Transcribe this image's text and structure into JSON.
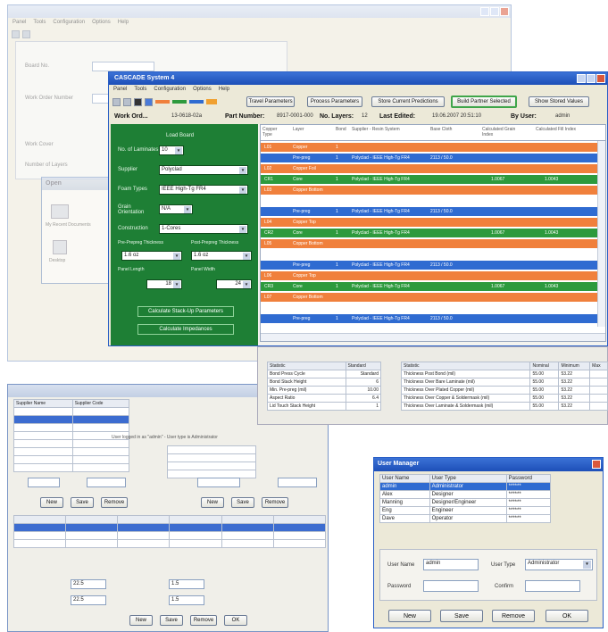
{
  "bg_window": {
    "title": "",
    "menu": [
      "Panel",
      "Tools",
      "Configuration",
      "Options",
      "Help"
    ],
    "field_labels": [
      "Board No.",
      "Work Order Number",
      "Work Cover",
      "Number of Layers"
    ]
  },
  "explorer": {
    "title": "Open",
    "items": [
      "My Recent Documents",
      "Desktop"
    ]
  },
  "left_window": {
    "status": "User logged in as \"admin\" - User type is Administrator",
    "table_headers": [
      "Supplier Name",
      "Supplier Code"
    ],
    "buttons": [
      "New",
      "Save",
      "Remove"
    ],
    "mid_buttons": [
      "New",
      "Save",
      "Remove"
    ],
    "bottom_buttons": [
      "New",
      "Save",
      "Remove",
      "OK"
    ],
    "inputs": [
      "22.5",
      "1.5",
      "22.5",
      "1.5"
    ]
  },
  "main_window": {
    "title": "CASCADE System 4",
    "menu": [
      "Panel",
      "Tools",
      "Configuration",
      "Options",
      "Help"
    ],
    "buttons": [
      "Travel Parameters",
      "Process Parameters",
      "Store Current Predictions",
      "Build Partner Selected",
      "Show Stored Values"
    ],
    "info": {
      "work_order_label": "Work Ord...",
      "work_order_value": "13-0618-02a",
      "part_number_label": "Part Number:",
      "part_number_value": "8917-0001-000",
      "layers_label": "No. Layers:",
      "layers_value": "12",
      "last_edited_label": "Last Edited:",
      "last_edited_value": "19.06.2007 20:51:10",
      "by_user_label": "By User:",
      "by_user_value": "admin"
    },
    "panel": {
      "heading": "Load Board",
      "fields": [
        {
          "label": "No. of Laminates",
          "value": "10"
        },
        {
          "label": "Supplier",
          "value": "Polyclad"
        },
        {
          "label": "Foam Types",
          "value": "IEEE High-Tg FR4"
        },
        {
          "label": "Grain Orientation",
          "value": "N/A"
        },
        {
          "label": "Construction",
          "value": "1-Cores"
        }
      ],
      "pair_labels": [
        "Pre-Prepreg Thickness",
        "Post-Prepreg Thickness"
      ],
      "pair_values": [
        "1.6 oz",
        "1.6 oz"
      ],
      "dim_labels": [
        "Panel Length",
        "Panel Width"
      ],
      "dim_values": [
        "18",
        "24"
      ],
      "action_buttons": [
        "Calculate Stack-Up Parameters",
        "Calculate Impedances"
      ]
    },
    "grid_headers": [
      "Copper Type",
      "Layer",
      "Bond",
      "Supplier - Resin System",
      "Base Cloth",
      "Calculated Grain Index",
      "Calculated Fill Index"
    ],
    "rows": [
      {
        "color": "o",
        "c1": "L01",
        "c2": "Copper",
        "c3": "1",
        "c4": "",
        "c5": "",
        "c6": "",
        "c7": ""
      },
      {
        "color": "b",
        "c1": "",
        "c2": "Pre-preg",
        "c3": "1",
        "c4": "Polyclad - IEEE High-Tg FR4",
        "c5": "2113 / 50.0",
        "c6": "",
        "c7": ""
      },
      {
        "color": "o",
        "c1": "L02",
        "c2": "Copper Foil",
        "c3": "",
        "c4": "",
        "c5": "",
        "c6": "",
        "c7": ""
      },
      {
        "color": "g",
        "c1": "CR1",
        "c2": "Core",
        "c3": "1",
        "c4": "Polyclad - IEEE High-Tg FR4",
        "c5": "",
        "c6": "1.0067",
        "c7": "1.0043"
      },
      {
        "color": "o",
        "c1": "L03",
        "c2": "Copper Bottom",
        "c3": "",
        "c4": "",
        "c5": "",
        "c6": "",
        "c7": ""
      },
      {
        "color": "w",
        "c1": "",
        "c2": "",
        "c3": "",
        "c4": "",
        "c5": "",
        "c6": "",
        "c7": ""
      },
      {
        "color": "b",
        "c1": "",
        "c2": "Pre-preg",
        "c3": "1",
        "c4": "Polyclad - IEEE High-Tg FR4",
        "c5": "2113 / 50.0",
        "c6": "",
        "c7": ""
      },
      {
        "color": "o",
        "c1": "L04",
        "c2": "Copper Top",
        "c3": "",
        "c4": "",
        "c5": "",
        "c6": "",
        "c7": ""
      },
      {
        "color": "g",
        "c1": "CR2",
        "c2": "Core",
        "c3": "1",
        "c4": "Polyclad - IEEE High-Tg FR4",
        "c5": "",
        "c6": "1.0067",
        "c7": "1.0043"
      },
      {
        "color": "o",
        "c1": "L05",
        "c2": "Copper Bottom",
        "c3": "",
        "c4": "",
        "c5": "",
        "c6": "",
        "c7": ""
      },
      {
        "color": "w",
        "c1": "",
        "c2": "",
        "c3": "",
        "c4": "",
        "c5": "",
        "c6": "",
        "c7": ""
      },
      {
        "color": "b",
        "c1": "",
        "c2": "Pre-preg",
        "c3": "1",
        "c4": "Polyclad - IEEE High-Tg FR4",
        "c5": "2113 / 50.0",
        "c6": "",
        "c7": ""
      },
      {
        "color": "o",
        "c1": "L06",
        "c2": "Copper Top",
        "c3": "",
        "c4": "",
        "c5": "",
        "c6": "",
        "c7": ""
      },
      {
        "color": "g",
        "c1": "CR3",
        "c2": "Core",
        "c3": "1",
        "c4": "Polyclad - IEEE High-Tg FR4",
        "c5": "",
        "c6": "1.0067",
        "c7": "1.0043"
      },
      {
        "color": "o",
        "c1": "L07",
        "c2": "Copper Bottom",
        "c3": "",
        "c4": "",
        "c5": "",
        "c6": "",
        "c7": ""
      },
      {
        "color": "w",
        "c1": "",
        "c2": "",
        "c3": "",
        "c4": "",
        "c5": "",
        "c6": "",
        "c7": ""
      },
      {
        "color": "b",
        "c1": "",
        "c2": "Pre-preg",
        "c3": "1",
        "c4": "Polyclad - IEEE High-Tg FR4",
        "c5": "2113 / 50.0",
        "c6": "",
        "c7": ""
      }
    ],
    "stats_left": {
      "headers": [
        "Statistic",
        "Standard"
      ],
      "rows": [
        [
          "Bond Press Cycle",
          "Standard"
        ],
        [
          "Bond Stack Height",
          "6"
        ],
        [
          "Min. Pre-preg (mil)",
          "10.00"
        ],
        [
          "Aspect Ratio",
          "6.4"
        ],
        [
          "Lid Touch Stack Height",
          "1"
        ]
      ]
    },
    "stats_right": {
      "headers": [
        "Statistic",
        "Nominal",
        "Minimum",
        "Max"
      ],
      "rows": [
        [
          "Thickness Post Bond (mil)",
          "55.00",
          "53.22",
          ""
        ],
        [
          "Thickness Over Bare Laminate (mil)",
          "55.00",
          "53.22",
          ""
        ],
        [
          "Thickness Over Plated Copper (mil)",
          "55.00",
          "53.22",
          ""
        ],
        [
          "Thickness Over Copper & Soldermask (mil)",
          "55.00",
          "53.22",
          ""
        ],
        [
          "Thickness Over Laminate & Soldermask (mil)",
          "55.00",
          "53.22",
          ""
        ]
      ]
    }
  },
  "user_manager": {
    "title": "User Manager",
    "headers": [
      "User Name",
      "User Type",
      "Password"
    ],
    "rows": [
      [
        "admin",
        "Administrator",
        "******"
      ],
      [
        "Alex",
        "Designer",
        "******"
      ],
      [
        "Manning",
        "Designer/Engineer",
        "******"
      ],
      [
        "Eng",
        "Engineer",
        "******"
      ],
      [
        "Dave",
        "Operator",
        "******"
      ]
    ],
    "labels": {
      "user_name": "User Name",
      "user_type": "User Type",
      "password": "Password",
      "confirm": "Confirm"
    },
    "values": {
      "user_name": "admin",
      "user_type": "Administrator",
      "password": "",
      "confirm": ""
    },
    "buttons": [
      "New",
      "Save",
      "Remove",
      "OK"
    ]
  },
  "colors": {
    "orange": "#f0803c",
    "blue": "#2f6bd1",
    "green": "#2d9a3d",
    "panel_green": "#1e7f35",
    "titlebar": "#2a5fc6"
  }
}
